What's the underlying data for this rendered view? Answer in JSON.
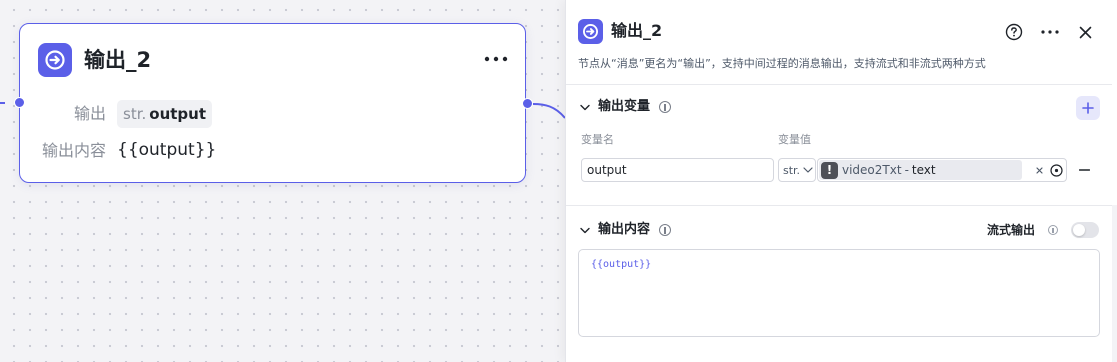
{
  "canvas_node": {
    "title": "输出_2",
    "output_label": "输出",
    "output_type": "str.",
    "output_name": "output",
    "content_label": "输出内容",
    "content_value": "{{output}}"
  },
  "panel": {
    "title": "输出_2",
    "description": "节点从“消息”更名为“输出”，支持中间过程的消息输出，支持流式和非流式两种方式",
    "output_variables": {
      "title": "输出变量",
      "col_name": "变量名",
      "col_value": "变量值",
      "rows": [
        {
          "name": "output",
          "type": "str.",
          "ref_node": "video2Txt",
          "ref_separator": "-",
          "ref_var": "text"
        }
      ]
    },
    "output_content": {
      "title": "输出内容",
      "stream_label": "流式输出",
      "stream_enabled": false,
      "value": "{{output}}"
    }
  },
  "colors": {
    "accent": "#5b5fe8",
    "canvas_bg": "#f3f3f6"
  }
}
